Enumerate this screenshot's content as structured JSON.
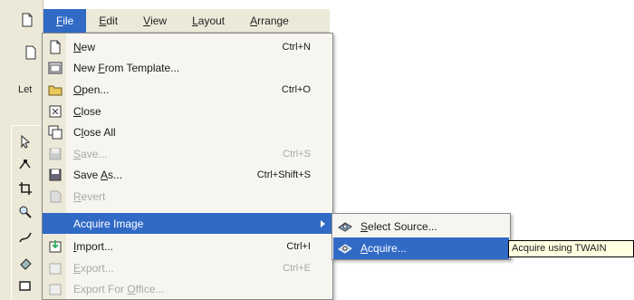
{
  "menubar": {
    "items": [
      {
        "label": "File",
        "accel": "F",
        "rest": "ile",
        "active": true
      },
      {
        "label": "Edit",
        "accel": "E",
        "rest": "dit",
        "active": false
      },
      {
        "label": "View",
        "accel": "V",
        "rest": "iew",
        "active": false
      },
      {
        "label": "Layout",
        "accel": "L",
        "rest": "ayout",
        "active": false
      },
      {
        "label": "Arrange",
        "accel": "A",
        "rest": "rrange",
        "active": false
      }
    ]
  },
  "toolbar": {
    "partial_text": "Let"
  },
  "file_menu": {
    "items": [
      {
        "label": "New",
        "accel": "N",
        "rest": "ew",
        "shortcut": "Ctrl+N",
        "icon": "new-document-icon",
        "enabled": true
      },
      {
        "label": "New From Template...",
        "pre": "New ",
        "accel": "F",
        "rest": "rom Template...",
        "shortcut": "",
        "icon": "new-from-template-icon",
        "enabled": true
      },
      {
        "label": "Open...",
        "accel": "O",
        "rest": "pen...",
        "shortcut": "Ctrl+O",
        "icon": "open-folder-icon",
        "enabled": true
      },
      {
        "label": "Close",
        "accel": "C",
        "rest": "lose",
        "shortcut": "",
        "icon": "close-document-icon",
        "enabled": true
      },
      {
        "label": "Close All",
        "pre": "C",
        "accel": "l",
        "rest": "ose All",
        "shortcut": "",
        "icon": "close-all-icon",
        "enabled": true
      },
      {
        "label": "Save...",
        "accel": "S",
        "rest": "ave...",
        "shortcut": "Ctrl+S",
        "icon": "save-icon",
        "enabled": false
      },
      {
        "label": "Save As...",
        "pre": "Save ",
        "accel": "A",
        "rest": "s...",
        "shortcut": "Ctrl+Shift+S",
        "icon": "save-as-icon",
        "enabled": true
      },
      {
        "label": "Revert",
        "accel": "R",
        "rest": "evert",
        "shortcut": "",
        "icon": "revert-icon",
        "enabled": false
      },
      {
        "label": "Acquire Image",
        "shortcut": "",
        "icon": "",
        "enabled": true,
        "highlighted": true,
        "submenu": true
      },
      {
        "label": "Import...",
        "accel": "I",
        "rest": "mport...",
        "shortcut": "Ctrl+I",
        "icon": "import-icon",
        "enabled": true
      },
      {
        "label": "Export...",
        "accel": "E",
        "rest": "xport...",
        "shortcut": "Ctrl+E",
        "icon": "export-icon",
        "enabled": false
      },
      {
        "label": "Export For Office...",
        "pre": "Export For ",
        "accel": "O",
        "rest": "ffice...",
        "shortcut": "",
        "icon": "export-office-icon",
        "enabled": false
      }
    ]
  },
  "acquire_submenu": {
    "items": [
      {
        "label": "Select Source...",
        "accel": "S",
        "rest": "elect Source...",
        "icon": "scanner-icon",
        "highlighted": false
      },
      {
        "label": "Acquire...",
        "accel": "A",
        "rest": "cquire...",
        "icon": "scanner-acquire-icon",
        "highlighted": true
      }
    ]
  },
  "tooltip": {
    "text": "Acquire using TWAIN"
  },
  "colors": {
    "highlight": "#316ac5",
    "menu_bg": "#f6f5f0",
    "gutter": "#ece9d8",
    "disabled": "#a9a9a9"
  }
}
